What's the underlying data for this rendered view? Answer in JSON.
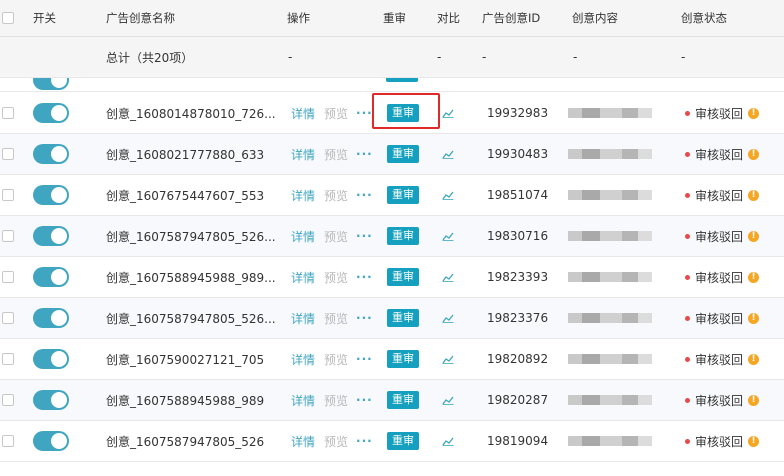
{
  "header": {
    "col_switch": "开关",
    "col_name": "广告创意名称",
    "col_ops": "操作",
    "col_review": "重审",
    "col_compare": "对比",
    "col_id": "广告创意ID",
    "col_content": "创意内容",
    "col_status": "创意状态"
  },
  "summary": {
    "label": "总计（共20项）",
    "ops": "-",
    "compare": "-",
    "id": "-",
    "content": "-",
    "status": "-"
  },
  "actions": {
    "details": "详情",
    "preview": "预览",
    "more": "···",
    "review": "重审"
  },
  "rows": [
    {
      "name": "创意_1608014878010_726...",
      "id": "19932983",
      "status": "审核驳回"
    },
    {
      "name": "创意_1608021777880_633",
      "id": "19930483",
      "status": "审核驳回"
    },
    {
      "name": "创意_1607675447607_553",
      "id": "19851074",
      "status": "审核驳回"
    },
    {
      "name": "创意_1607587947805_526...",
      "id": "19830716",
      "status": "审核驳回"
    },
    {
      "name": "创意_1607588945988_989...",
      "id": "19823393",
      "status": "审核驳回"
    },
    {
      "name": "创意_1607587947805_526...",
      "id": "19823376",
      "status": "审核驳回"
    },
    {
      "name": "创意_1607590027121_705",
      "id": "19820892",
      "status": "审核驳回"
    },
    {
      "name": "创意_1607588945988_989",
      "id": "19820287",
      "status": "审核驳回"
    },
    {
      "name": "创意_1607587947805_526",
      "id": "19819094",
      "status": "审核驳回"
    }
  ],
  "colors": {
    "accent": "#14a0be",
    "toggle": "#3fa5c0",
    "reject_dot": "#e84a4a",
    "info": "#f5a623",
    "highlight": "#e02a2a"
  }
}
